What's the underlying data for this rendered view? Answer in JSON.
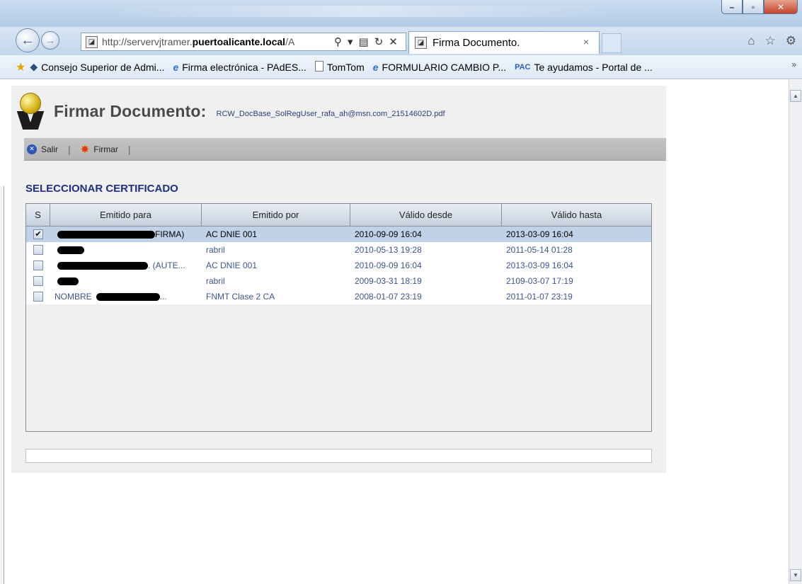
{
  "browser": {
    "address": {
      "prefix": "http://servervjtramer.",
      "domain": "puertoalicante.local",
      "suffix": "/A"
    },
    "tab": {
      "title": "Firma Documento.",
      "close": "×"
    },
    "favorites": [
      {
        "label": "Consejo Superior de Admi...",
        "icon": "diamond-icon"
      },
      {
        "label": "Firma electrónica - PAdES...",
        "icon": "ie-icon"
      },
      {
        "label": "TomTom",
        "icon": "document-icon"
      },
      {
        "label": "FORMULARIO CAMBIO P...",
        "icon": "ie-icon"
      },
      {
        "label": "Te ayudamos - Portal de ...",
        "icon": "pac-icon"
      }
    ],
    "favorites_more": "»"
  },
  "page": {
    "title": "Firmar Documento:",
    "filename": "RCW_DocBase_SolRegUser_rafa_ah@msn.com_21514602D.pdf",
    "toolbar": {
      "salir": "Salir",
      "firmar": "Firmar",
      "separator": "|"
    },
    "section_title": "SELECCIONAR CERTIFICADO",
    "table": {
      "headers": [
        "S",
        "Emitido para",
        "Emitido por",
        "Válido desde",
        "Válido hasta"
      ],
      "rows": [
        {
          "checked": true,
          "para_prefix": "",
          "para_suffix": "FIRMA)",
          "por": "AC DNIE 001",
          "desde": "2010-09-09 16:04",
          "hasta": "2013-03-09 16:04"
        },
        {
          "checked": false,
          "para_prefix": "",
          "para_suffix": "",
          "por": "rabril",
          "desde": "2010-05-13 19:28",
          "hasta": "2011-05-14 01:28"
        },
        {
          "checked": false,
          "para_prefix": "",
          "para_suffix": ". (AUTE...",
          "por": "AC DNIE 001",
          "desde": "2010-09-09 16:04",
          "hasta": "2013-03-09 16:04"
        },
        {
          "checked": false,
          "para_prefix": "",
          "para_suffix": "",
          "por": "rabril",
          "desde": "2009-03-31 18:19",
          "hasta": "2109-03-07 17:19"
        },
        {
          "checked": false,
          "para_prefix": "NOMBRE",
          "para_suffix": "...",
          "por": "FNMT Clase 2 CA",
          "desde": "2008-01-07 23:19",
          "hasta": "2011-01-07 23:19"
        }
      ],
      "check_mark": "✔"
    }
  }
}
